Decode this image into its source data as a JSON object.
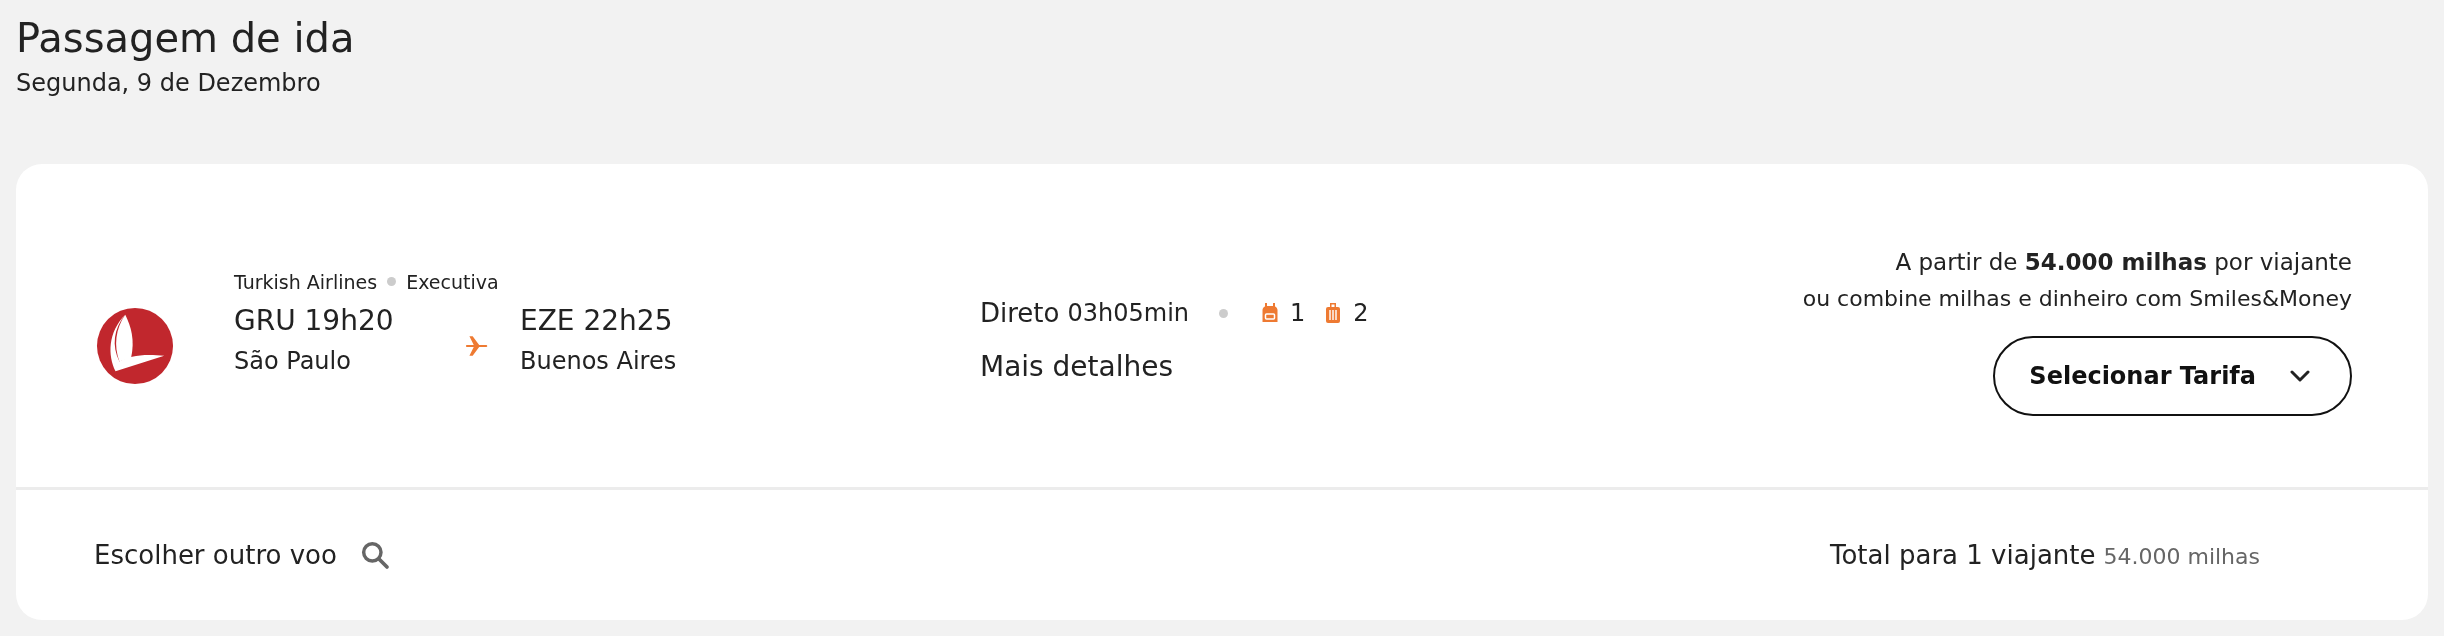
{
  "header": {
    "title": "Passagem de ida",
    "date": "Segunda, 9 de Dezembro"
  },
  "flight": {
    "airline": "Turkish Airlines",
    "cabin": "Executiva",
    "origin": {
      "departure": "GRU 19h20",
      "city": "São Paulo"
    },
    "destination": {
      "arrival": "EZE 22h25",
      "city": "Buenos Aires"
    },
    "stops": "Direto",
    "duration": "03h05min",
    "baggage": [
      {
        "kind": "backpack",
        "count": "1"
      },
      {
        "kind": "suitcase",
        "count": "2"
      }
    ],
    "details_link": "Mais detalhes"
  },
  "price": {
    "line_1": "A partir de **54.000 milhas**  por viajante",
    "line_2": "ou combine milhas e dinheiro com Smiles&Money",
    "button": "Selecionar Tarifa"
  },
  "footer": {
    "other_flight": "Escolher outro voo",
    "total_label": "Total para 1 viajante",
    "total_value": "54.000 milhas"
  }
}
